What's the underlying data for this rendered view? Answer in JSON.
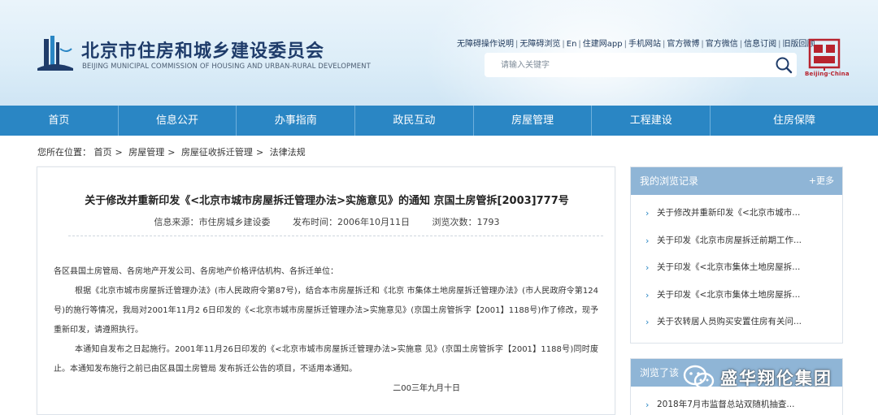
{
  "header": {
    "site_title": "北京市住房和城乡建设委员会",
    "site_subtitle": "BEIJING MUNICIPAL COMMISSION OF HOUSING AND URBAN-RURAL DEVELOPMENT",
    "seal_text": "Beijing·China",
    "toplinks": [
      "无障碍操作说明",
      "无障碍浏览",
      "En",
      "住建网app",
      "手机网站",
      "官方微博",
      "官方微信",
      "信息订阅",
      "旧版回顾"
    ],
    "search_placeholder": "请输入关键字"
  },
  "nav": [
    "首页",
    "信息公开",
    "办事指南",
    "政民互动",
    "房屋管理",
    "工程建设",
    "住房保障"
  ],
  "breadcrumb": {
    "prefix": "您所在位置：",
    "items": [
      "首页",
      "房屋管理",
      "房屋征收拆迁管理",
      "法律法规"
    ]
  },
  "article": {
    "title": "关于修改并重新印发《<北京市城市房屋拆迁管理办法>实施意见》的通知 京国土房管拆[2003]777号",
    "source": "信息来源：市住房城乡建设委",
    "publish_time": "发布时间：2006年10月11日",
    "views": "浏览次数：1793",
    "salutation": "各区县国土房管局、各房地产开发公司、各房地产价格评估机构、各拆迁单位：",
    "para1": "根据《北京市城市房屋拆迁管理办法》(市人民政府令第87号)，结合本市房屋拆迁和《北京 市集体土地房屋拆迁管理办法》(市人民政府令第124号)的施行等情况，我局对2001年11月2 6日印发的《<北京市城市房屋拆迁管理办法>实施意见》(京国土房管拆字【2001】1188号)作了修改，现予重新印发，请遵照执行。",
    "para2": "本通知自发布之日起施行。2001年11月26日印发的《<北京市城市房屋拆迁管理办法>实施意 见》(京国土房管拆字【2001】1188号)同时废止。本通知发布施行之前已由区县国土房管局 发布拆迁公告的项目，不适用本通知。",
    "date": "二00三年九月十日"
  },
  "sidebar": {
    "history_title": "我的浏览记录",
    "more": "+更多",
    "history_items": [
      "关于修改并重新印发《<北京市城市...",
      "关于印发《北京市房屋拆迁前期工作...",
      "关于印发《<北京市集体土地房屋拆...",
      "关于印发《<北京市集体土地房屋拆...",
      "关于农转居人员购买安置住房有关问..."
    ],
    "second_title": "浏览了该",
    "second_items": [
      "2018年7月市监督总站双随机抽查..."
    ]
  },
  "watermark": {
    "text": "盛华翔伦集团"
  },
  "colors": {
    "nav_blue": "#2a86c4",
    "side_head": "#8fb5d6",
    "title_navy": "#1f3c6a",
    "seal_red": "#b8232e"
  }
}
